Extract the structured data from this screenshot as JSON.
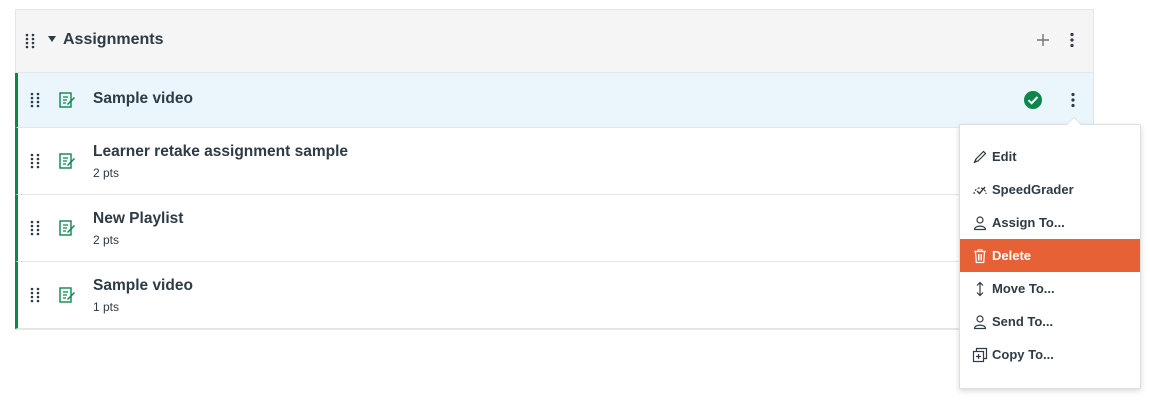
{
  "module": {
    "title": "Assignments"
  },
  "items": [
    {
      "title": "Sample video",
      "pts": "",
      "published": true
    },
    {
      "title": "Learner retake assignment sample",
      "pts": "2 pts"
    },
    {
      "title": "New Playlist",
      "pts": "2 pts"
    },
    {
      "title": "Sample video",
      "pts": "1 pts"
    }
  ],
  "menu": {
    "items": [
      {
        "label": "Edit",
        "icon": "pencil-icon"
      },
      {
        "label": "SpeedGrader",
        "icon": "speedgrader-icon"
      },
      {
        "label": "Assign To...",
        "icon": "user-icon"
      },
      {
        "label": "Delete",
        "icon": "trash-icon",
        "active": true
      },
      {
        "label": "Move To...",
        "icon": "move-icon"
      },
      {
        "label": "Send To...",
        "icon": "user-send-icon"
      },
      {
        "label": "Copy To...",
        "icon": "copy-icon"
      }
    ]
  },
  "colors": {
    "accent_green": "#0b874b",
    "active_menu": "#e66135",
    "selected_row": "#eaf6fc"
  }
}
